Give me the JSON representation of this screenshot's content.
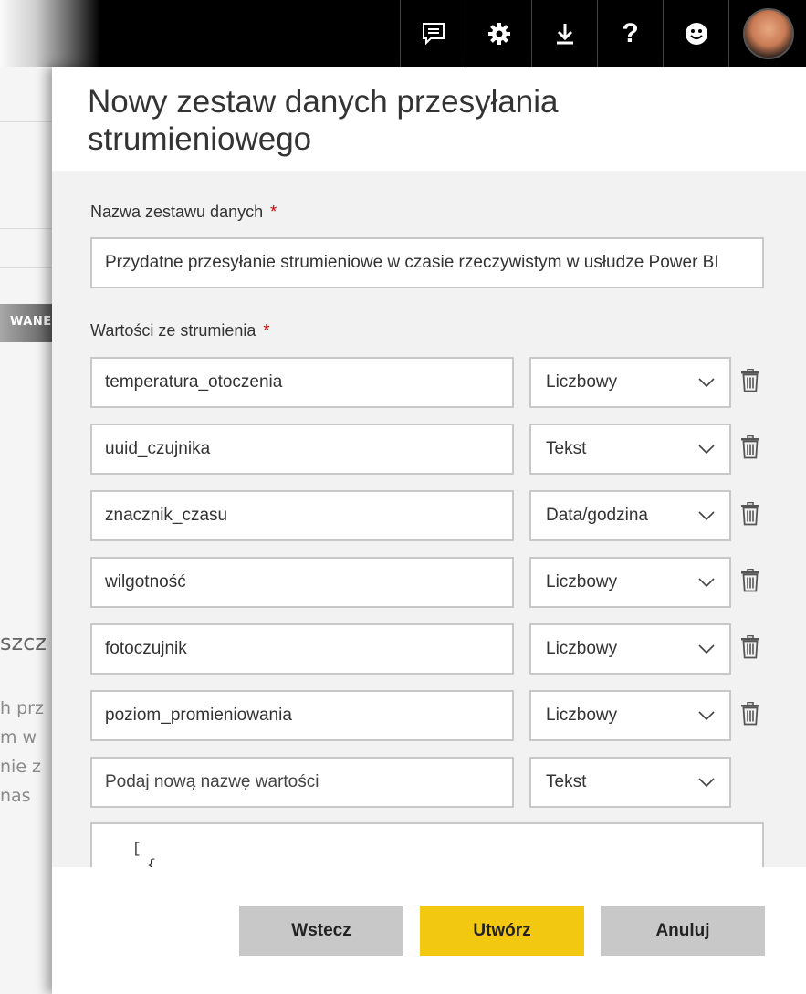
{
  "background": {
    "tab_label": "WANE",
    "text_fragments": [
      "szcz",
      "h prz",
      "m w",
      "nie z",
      "nas"
    ]
  },
  "topbar": {
    "icons": [
      "feedback-icon",
      "gear-icon",
      "download-icon",
      "help-icon",
      "smiley-icon"
    ],
    "help_glyph": "?"
  },
  "panel": {
    "title": "Nowy zestaw danych przesyłania strumieniowego",
    "dataset_name_label": "Nazwa zestawu danych",
    "dataset_name_required": "*",
    "dataset_name_value": "Przydatne przesyłanie strumieniowe w czasie rzeczywistym w usłudze Power BI",
    "stream_values_label": "Wartości ze strumienia",
    "stream_values_required": "*",
    "values": [
      {
        "name": "temperatura_otoczenia",
        "type": "Liczbowy"
      },
      {
        "name": "uuid_czujnika",
        "type": "Tekst"
      },
      {
        "name": "znacznik_czasu",
        "type": "Data/godzina"
      },
      {
        "name": "wilgotność",
        "type": "Liczbowy"
      },
      {
        "name": "fotoczujnik",
        "type": "Liczbowy"
      },
      {
        "name": "poziom_promieniowania",
        "type": "Liczbowy"
      }
    ],
    "new_value_placeholder": "Podaj nową nazwę wartości",
    "new_value_type": "Tekst",
    "json_preview": "[",
    "json_preview_line2": "{"
  },
  "footer": {
    "back_label": "Wstecz",
    "create_label": "Utwórz",
    "cancel_label": "Anuluj"
  },
  "colors": {
    "accent_yellow": "#f2c811",
    "required_red": "#cc0000",
    "topbar": "#000000"
  }
}
